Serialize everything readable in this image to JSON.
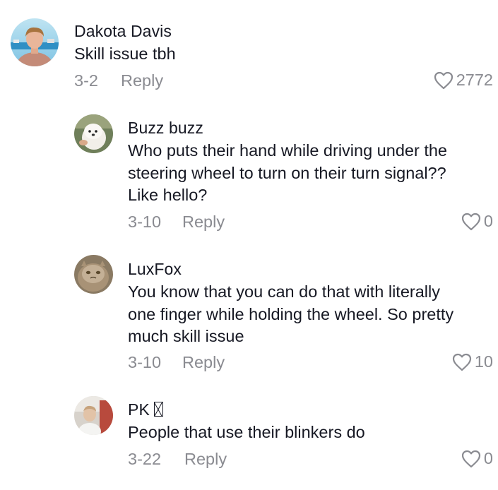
{
  "comments": [
    {
      "username": "Dakota Davis",
      "text_lines": [
        "Skill issue tbh"
      ],
      "date": "3-2",
      "reply_label": "Reply",
      "likes": "2772"
    },
    {
      "username": "Buzz buzz",
      "text_lines": [
        "Who puts their hand while driving under the",
        "steering wheel to turn on their turn signal??",
        "Like hello?"
      ],
      "date": "3-10",
      "reply_label": "Reply",
      "likes": "0"
    },
    {
      "username": "LuxFox",
      "text_lines": [
        "You know that you can do that with literally",
        "one finger while holding the wheel. So pretty",
        "much skill issue"
      ],
      "date": "3-10",
      "reply_label": "Reply",
      "likes": "10"
    },
    {
      "username": "PK",
      "text_lines": [
        "People that use their blinkers do"
      ],
      "date": "3-22",
      "reply_label": "Reply",
      "likes": "0"
    }
  ],
  "colors": {
    "text": "#161823",
    "muted": "#8a8b91"
  },
  "icons": {
    "like": "heart-outline-icon",
    "unsupported_glyph": "missing-glyph-box"
  }
}
